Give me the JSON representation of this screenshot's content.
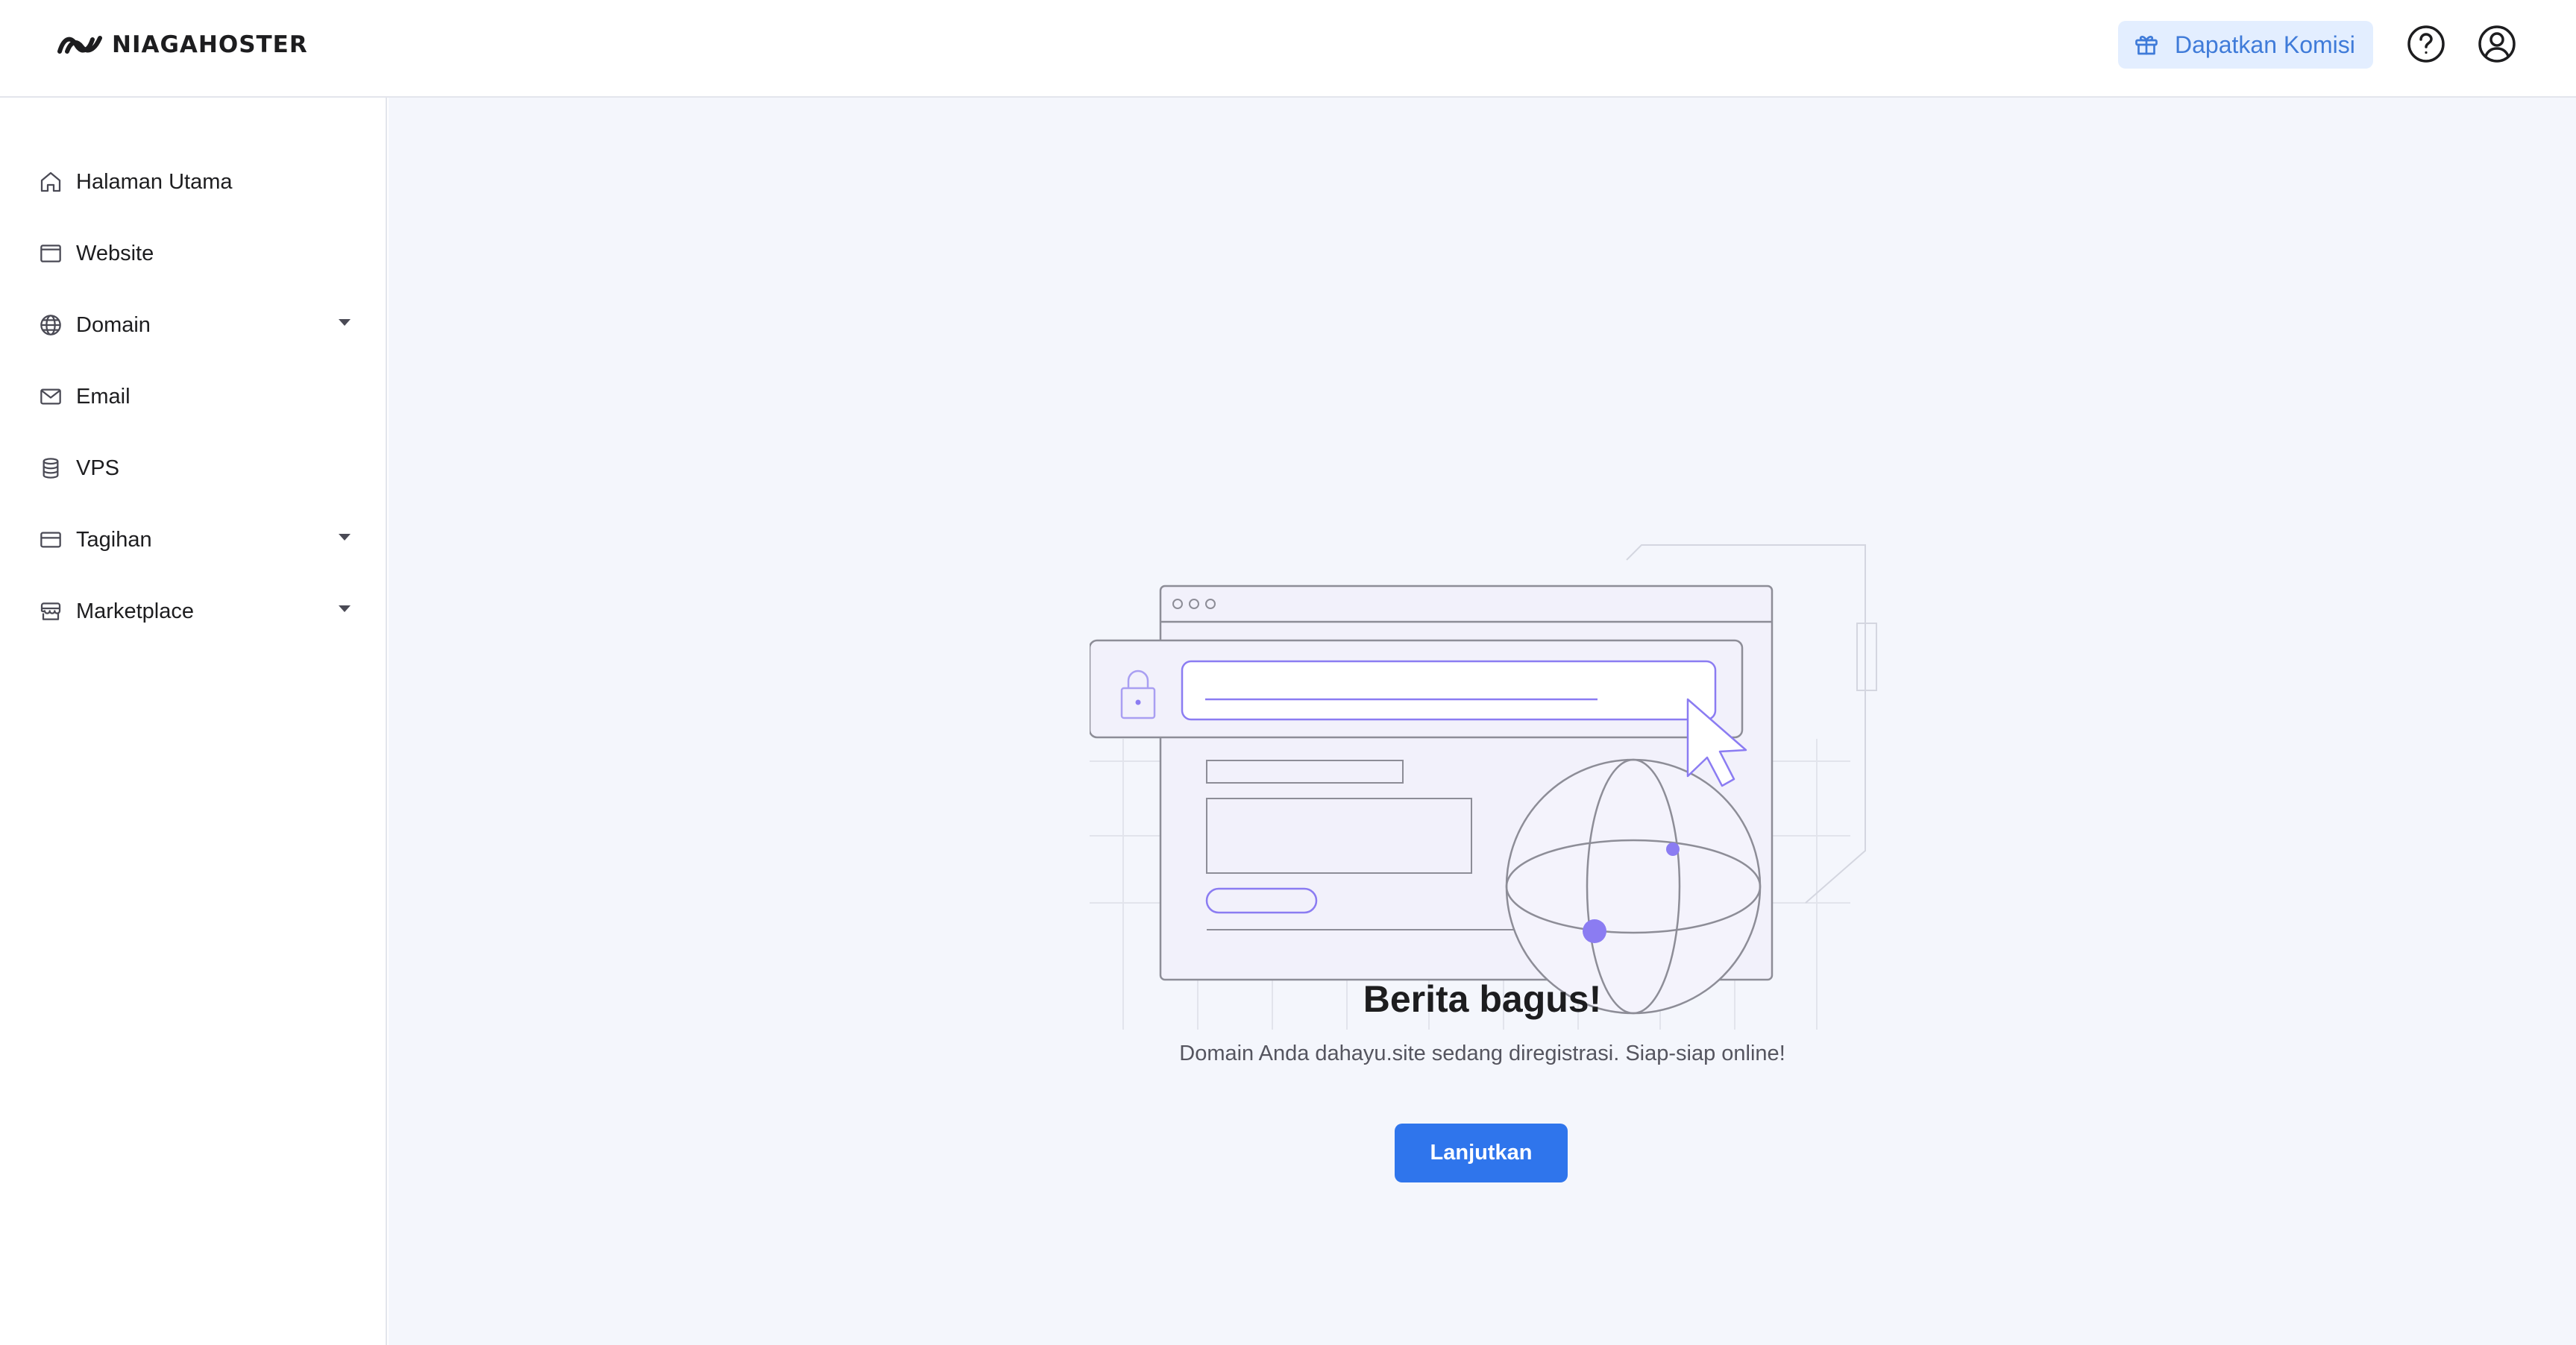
{
  "brand": {
    "name": "NIAGAHOSTER"
  },
  "header": {
    "commission_label": "Dapatkan Komisi",
    "help_icon": "question-circle-icon",
    "user_icon": "user-circle-icon"
  },
  "sidebar": {
    "items": [
      {
        "label": "Halaman Utama",
        "icon": "home-icon",
        "has_dropdown": false
      },
      {
        "label": "Website",
        "icon": "browser-window-icon",
        "has_dropdown": false
      },
      {
        "label": "Domain",
        "icon": "globe-icon",
        "has_dropdown": true
      },
      {
        "label": "Email",
        "icon": "envelope-icon",
        "has_dropdown": false
      },
      {
        "label": "VPS",
        "icon": "database-icon",
        "has_dropdown": false
      },
      {
        "label": "Tagihan",
        "icon": "credit-card-icon",
        "has_dropdown": true
      },
      {
        "label": "Marketplace",
        "icon": "store-icon",
        "has_dropdown": true
      }
    ]
  },
  "main": {
    "headline": "Berita bagus!",
    "message": "Domain Anda dahayu.site sedang diregistrasi. Siap-siap online!",
    "continue_label": "Lanjutkan"
  },
  "colors": {
    "accent": "#2f75ec",
    "commission_bg": "#e3eeff",
    "commission_text": "#3f7bd9",
    "illustration_purple": "#8b7cf2",
    "main_bg": "#f4f6fc"
  }
}
